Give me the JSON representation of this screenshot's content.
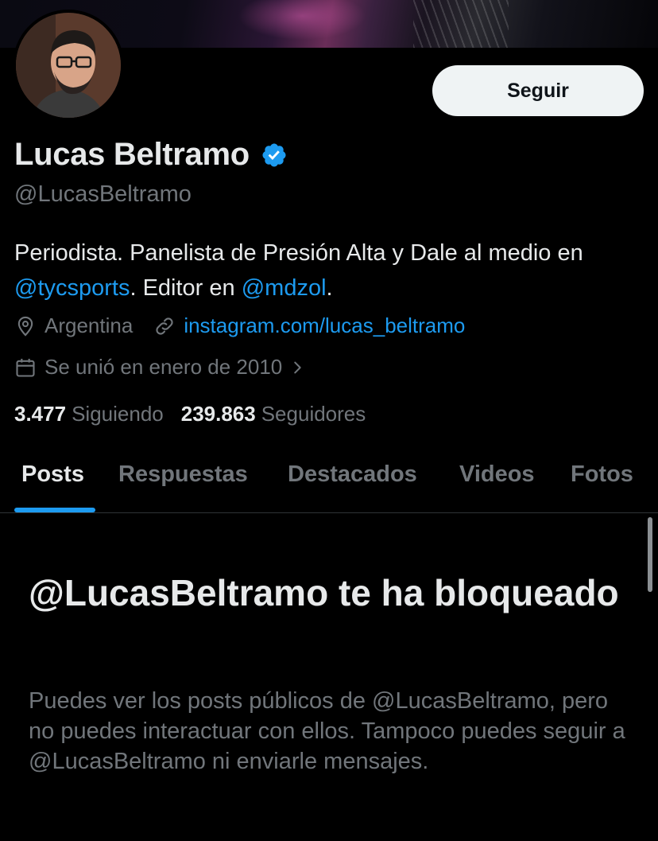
{
  "profile": {
    "name": "Lucas Beltramo",
    "handle": "@LucasBeltramo",
    "follow_label": "Seguir",
    "bio": {
      "part1": "Periodista. Panelista de Presión Alta y Dale al medio en ",
      "link1": "@tycsports",
      "part2": ". Editor en ",
      "link2": "@mdzol",
      "part3": "."
    },
    "location": "Argentina",
    "website": "instagram.com/lucas_beltramo",
    "joined": "Se unió en enero de 2010",
    "following_count": "3.477",
    "following_label": "Siguiendo",
    "followers_count": "239.863",
    "followers_label": "Seguidores"
  },
  "tabs": [
    {
      "label": "Posts",
      "active": true
    },
    {
      "label": "Respuestas",
      "active": false
    },
    {
      "label": "Destacados",
      "active": false
    },
    {
      "label": "Videos",
      "active": false
    },
    {
      "label": "Fotos",
      "active": false
    }
  ],
  "blocked": {
    "title": "@LucasBeltramo te ha bloqueado",
    "description": "Puedes ver los posts públicos de @LucasBeltramo, pero no puedes interactuar con ellos. Tampoco puedes seguir a @LucasBeltramo ni enviarle mensajes."
  },
  "colors": {
    "accent": "#1d9bf0",
    "background": "#000000",
    "text_primary": "#e7e9ea",
    "text_secondary": "#71767b"
  },
  "icons": {
    "verified": "verified-badge-icon",
    "location": "location-pin-icon",
    "link": "link-icon",
    "calendar": "calendar-icon",
    "chevron": "chevron-right-icon"
  }
}
